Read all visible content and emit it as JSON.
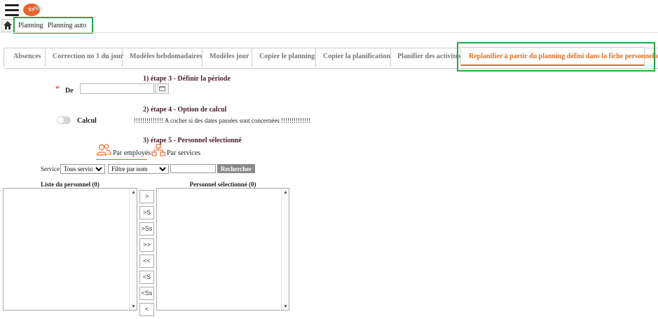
{
  "header": {
    "logo_text": "SY",
    "logo_rest": "NEL"
  },
  "breadcrumb": [
    "Planning",
    "Planning auto"
  ],
  "tabs": [
    "Absences",
    "Correction no 1 du jour",
    "Modèles hebdomadaires",
    "Modèles jour",
    "Copier le planning",
    "Copier la planification",
    "Planifier des activités"
  ],
  "active_tab": "Replanifier à partir du planning défini dans la fiche personnelle",
  "form": {
    "step3": "1) étape 3 - Définir la période",
    "required_mark": "*",
    "de_label": "De",
    "date_value": "",
    "step4": "2) étape 4 - Option de calcul",
    "calcul_label": "Calcul",
    "warning": "!!!!!!!!!!!!!! A cocher si des dates passées sont concernées !!!!!!!!!!!!!!",
    "step5": "3) étape 5 - Personnel sélectionné",
    "mode_employees": "Par employés",
    "mode_services": "Par services"
  },
  "filters": {
    "service_label": "Service",
    "service_selected": "Tous services",
    "filter_selected": "Filtre par nom",
    "search_value": "",
    "search_button": "Rechercher"
  },
  "lists": {
    "left_title": "Liste du personnel (0)",
    "right_title": "Personnel sélectionné (0)"
  },
  "move_buttons": [
    ">",
    ">S",
    ">Ss",
    ">>",
    "<<",
    "<S",
    "<Ss",
    "<"
  ],
  "colors": {
    "accent": "#e8632a",
    "highlight_green": "#27a844",
    "active_tab_text": "#e07020"
  }
}
